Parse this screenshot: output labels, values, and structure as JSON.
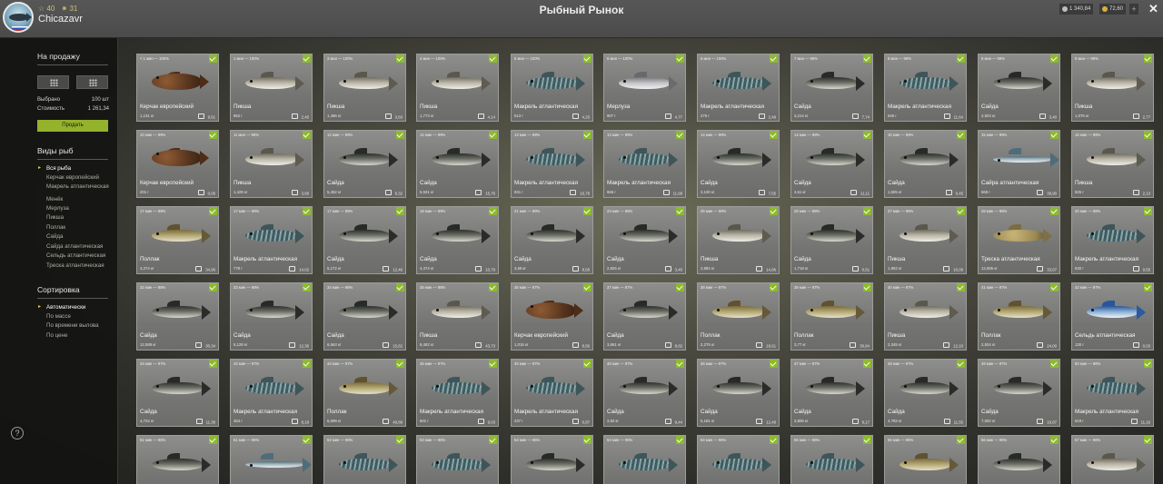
{
  "header": {
    "stat_level": "☆ 40",
    "stat_rank": "✷ 31",
    "username": "Chicazavr",
    "title": "Рыбный Рынок",
    "currency_silver": "1 340,84",
    "currency_gold": "72,60",
    "plus_label": "+",
    "close_label": "✕"
  },
  "sidebar": {
    "for_sale_title": "На продажу",
    "selected_label": "Выбрано",
    "selected_value": "100 шт",
    "cost_label": "Стоимость",
    "cost_value": "1 261,34",
    "sell_label": "Продать",
    "species_title": "Виды рыб",
    "species": [
      "Вся рыба",
      "Керчак европейский",
      "Макрель атлантическая",
      "Менёк",
      "Мерлуза",
      "Пикша",
      "Поллак",
      "Сайда",
      "Сайда атлантическая",
      "Сельдь атлантическая",
      "Треска атлантическая"
    ],
    "sort_title": "Сортировка",
    "sort_options": [
      "Автоматически",
      "По массе",
      "По времени вылова",
      "По цене"
    ],
    "help_label": "?"
  },
  "colors": {
    "accent": "#94b22c",
    "check": "#8dba2e",
    "card_bg": "#7e7e7c",
    "panel_bg": "#141412"
  },
  "cards": [
    {
      "age": "< 1 мин — 100%",
      "name": "Керчак европейский",
      "weight": "1,131 кг",
      "price": "9,51",
      "fish": "scorpion"
    },
    {
      "age": "1 мин — 100%",
      "name": "Пикша",
      "weight": "952 г",
      "price": "2,45",
      "fish": "haddock"
    },
    {
      "age": "3 мин — 100%",
      "name": "Пикша",
      "weight": "1,486 кг",
      "price": "3,83",
      "fish": "haddock"
    },
    {
      "age": "4 мин — 100%",
      "name": "Пикша",
      "weight": "1,773 кг",
      "price": "4,14",
      "fish": "haddock"
    },
    {
      "age": "5 мин — 100%",
      "name": "Макрель атлантическая",
      "weight": "513 г",
      "price": "4,25",
      "fish": "mackerel"
    },
    {
      "age": "6 мин — 100%",
      "name": "Мерлуза",
      "weight": "907 г",
      "price": "4,77",
      "fish": "hake"
    },
    {
      "age": "6 мин — 100%",
      "name": "Макрель атлантическая",
      "weight": "276 г",
      "price": "2,48",
      "fish": "mackerel"
    },
    {
      "age": "7 мин — 99%",
      "name": "Сайда",
      "weight": "3,214 кг",
      "price": "7,74",
      "fish": "saithe"
    },
    {
      "age": "8 мин — 99%",
      "name": "Макрель атлантическая",
      "weight": "646 г",
      "price": "11,64",
      "fish": "mackerel"
    },
    {
      "age": "8 мин — 99%",
      "name": "Сайда",
      "weight": "2,923 кг",
      "price": "3,40",
      "fish": "saithe"
    },
    {
      "age": "8 мин — 99%",
      "name": "Пикша",
      "weight": "1,076 кг",
      "price": "2,77",
      "fish": "haddock"
    },
    {
      "age": "10 мин — 99%",
      "name": "Керчак европейский",
      "weight": "201 г",
      "price": "0,06",
      "fish": "scorpion"
    },
    {
      "age": "11 мин — 99%",
      "name": "Пикша",
      "weight": "1,429 кг",
      "price": "3,68",
      "fish": "haddock"
    },
    {
      "age": "12 мин — 99%",
      "name": "Сайда",
      "weight": "5,452 кг",
      "price": "8,32",
      "fish": "saithe"
    },
    {
      "age": "12 мин — 99%",
      "name": "Сайда",
      "weight": "6,531 кг",
      "price": "15,76",
      "fish": "saithe"
    },
    {
      "age": "13 мин — 99%",
      "name": "Макрель атлантическая",
      "weight": "931 г",
      "price": "16,78",
      "fish": "mackerel"
    },
    {
      "age": "13 мин — 99%",
      "name": "Макрель атлантическая",
      "weight": "665 г",
      "price": "11,99",
      "fish": "mackerel"
    },
    {
      "age": "14 мин — 99%",
      "name": "Сайда",
      "weight": "3,130 кг",
      "price": "7,55",
      "fish": "saithe"
    },
    {
      "age": "14 мин — 99%",
      "name": "Сайда",
      "weight": "4,61 кг",
      "price": "11,11",
      "fish": "saithe"
    },
    {
      "age": "15 мин — 99%",
      "name": "Сайда",
      "weight": "1,505 кг",
      "price": "0,45",
      "fish": "saithe"
    },
    {
      "age": "15 мин — 99%",
      "name": "Сайра атлантическая",
      "weight": "569 г",
      "price": "39,90",
      "fish": "saury"
    },
    {
      "age": "16 мин — 99%",
      "name": "Пикша",
      "weight": "825 г",
      "price": "2,13",
      "fish": "haddock"
    },
    {
      "age": "17 мин — 99%",
      "name": "Поллак",
      "weight": "4,274 кг",
      "price": "34,96",
      "fish": "pollack"
    },
    {
      "age": "17 мин — 99%",
      "name": "Макрель атлантическая",
      "weight": "778 г",
      "price": "14,02",
      "fish": "mackerel"
    },
    {
      "age": "17 мин — 99%",
      "name": "Сайда",
      "weight": "5,172 кг",
      "price": "12,46",
      "fish": "saithe"
    },
    {
      "age": "18 мин — 99%",
      "name": "Сайда",
      "weight": "4,474 кг",
      "price": "10,78",
      "fish": "saithe"
    },
    {
      "age": "21 мин — 99%",
      "name": "Сайда",
      "weight": "3,58 кг",
      "price": "8,58",
      "fish": "saithe"
    },
    {
      "age": "23 мин — 98%",
      "name": "Сайда",
      "weight": "2,826 кг",
      "price": "3,40",
      "fish": "saithe"
    },
    {
      "age": "25 мин — 98%",
      "name": "Пикша",
      "weight": "2,882 кг",
      "price": "14,86",
      "fish": "haddock"
    },
    {
      "age": "26 мин — 98%",
      "name": "Сайда",
      "weight": "1,718 кг",
      "price": "0,51",
      "fish": "saithe"
    },
    {
      "age": "27 мин — 98%",
      "name": "Пикша",
      "weight": "1,952 кг",
      "price": "10,06",
      "fish": "haddock"
    },
    {
      "age": "28 мин — 98%",
      "name": "Треска атлантическая",
      "weight": "12,685 кг",
      "price": "33,67",
      "fish": "cod"
    },
    {
      "age": "30 мин — 98%",
      "name": "Макрель атлантическая",
      "weight": "530 г",
      "price": "9,55",
      "fish": "mackerel"
    },
    {
      "age": "32 мин — 98%",
      "name": "Сайда",
      "weight": "12,589 кг",
      "price": "30,34",
      "fish": "saithe"
    },
    {
      "age": "33 мин — 98%",
      "name": "Сайда",
      "weight": "5,128 кг",
      "price": "12,36",
      "fish": "saithe"
    },
    {
      "age": "34 мин — 98%",
      "name": "Сайда",
      "weight": "6,563 кг",
      "price": "15,82",
      "fish": "saithe"
    },
    {
      "age": "35 мин — 98%",
      "name": "Пикша",
      "weight": "8,482 кг",
      "price": "43,73",
      "fish": "haddock"
    },
    {
      "age": "36 мин — 97%",
      "name": "Керчак европейский",
      "weight": "1,016 кг",
      "price": "8,56",
      "fish": "scorpion"
    },
    {
      "age": "37 мин — 97%",
      "name": "Сайда",
      "weight": "3,661 кг",
      "price": "8,82",
      "fish": "saithe"
    },
    {
      "age": "38 мин — 97%",
      "name": "Поллак",
      "weight": "2,275 кг",
      "price": "18,61",
      "fish": "pollack"
    },
    {
      "age": "39 мин — 97%",
      "name": "Поллак",
      "weight": "3,77 кг",
      "price": "30,84",
      "fish": "pollack"
    },
    {
      "age": "40 мин — 97%",
      "name": "Пикша",
      "weight": "2,348 кг",
      "price": "12,10",
      "fish": "haddock"
    },
    {
      "age": "41 мин — 97%",
      "name": "Поллак",
      "weight": "2,934 кг",
      "price": "24,00",
      "fish": "pollack"
    },
    {
      "age": "42 мин — 97%",
      "name": "Сельдь атлантическая",
      "weight": "130 г",
      "price": "0,03",
      "fish": "herring"
    },
    {
      "age": "44 мин — 97%",
      "name": "Сайда",
      "weight": "4,722 кг",
      "price": "11,38",
      "fish": "saithe"
    },
    {
      "age": "44 мин — 97%",
      "name": "Макрель атлантическая",
      "weight": "454 г",
      "price": "8,18",
      "fish": "mackerel"
    },
    {
      "age": "44 мин — 97%",
      "name": "Поллак",
      "weight": "6,099 кг",
      "price": "49,89",
      "fish": "pollack"
    },
    {
      "age": "45 мин — 97%",
      "name": "Макрель атлантическая",
      "weight": "501 г",
      "price": "9,03",
      "fish": "mackerel"
    },
    {
      "age": "45 мин — 97%",
      "name": "Макрель атлантическая",
      "weight": "237 г",
      "price": "0,87",
      "fish": "mackerel"
    },
    {
      "age": "46 мин — 97%",
      "name": "Сайда",
      "weight": "3,92 кг",
      "price": "9,44",
      "fish": "saithe"
    },
    {
      "age": "46 мин — 97%",
      "name": "Сайда",
      "weight": "5,181 кг",
      "price": "12,48",
      "fish": "saithe"
    },
    {
      "age": "47 мин — 97%",
      "name": "Сайда",
      "weight": "3,806 кг",
      "price": "9,17",
      "fish": "saithe"
    },
    {
      "age": "48 мин — 97%",
      "name": "Сайда",
      "weight": "4,793 кг",
      "price": "11,55",
      "fish": "saithe"
    },
    {
      "age": "49 мин — 97%",
      "name": "Сайда",
      "weight": "7,002 кг",
      "price": "16,87",
      "fish": "saithe"
    },
    {
      "age": "50 мин — 96%",
      "name": "Макрель атлантическая",
      "weight": "619 г",
      "price": "11,16",
      "fish": "mackerel"
    },
    {
      "age": "51 мин — 96%",
      "name": "",
      "weight": "",
      "price": "",
      "fish": "saithe"
    },
    {
      "age": "51 мин — 96%",
      "name": "",
      "weight": "",
      "price": "",
      "fish": "saury"
    },
    {
      "age": "52 мин — 96%",
      "name": "",
      "weight": "",
      "price": "",
      "fish": "mackerel"
    },
    {
      "age": "53 мин — 96%",
      "name": "",
      "weight": "",
      "price": "",
      "fish": "mackerel"
    },
    {
      "age": "54 мин — 96%",
      "name": "",
      "weight": "",
      "price": "",
      "fish": "saithe"
    },
    {
      "age": "54 мин — 96%",
      "name": "",
      "weight": "",
      "price": "",
      "fish": "mackerel"
    },
    {
      "age": "54 мин — 96%",
      "name": "",
      "weight": "",
      "price": "",
      "fish": "mackerel"
    },
    {
      "age": "55 мин — 96%",
      "name": "",
      "weight": "",
      "price": "",
      "fish": "mackerel"
    },
    {
      "age": "55 мин — 96%",
      "name": "",
      "weight": "",
      "price": "",
      "fish": "pollack"
    },
    {
      "age": "56 мин — 96%",
      "name": "",
      "weight": "",
      "price": "",
      "fish": "saithe"
    },
    {
      "age": "57 мин — 96%",
      "name": "",
      "weight": "",
      "price": "",
      "fish": "haddock"
    }
  ]
}
